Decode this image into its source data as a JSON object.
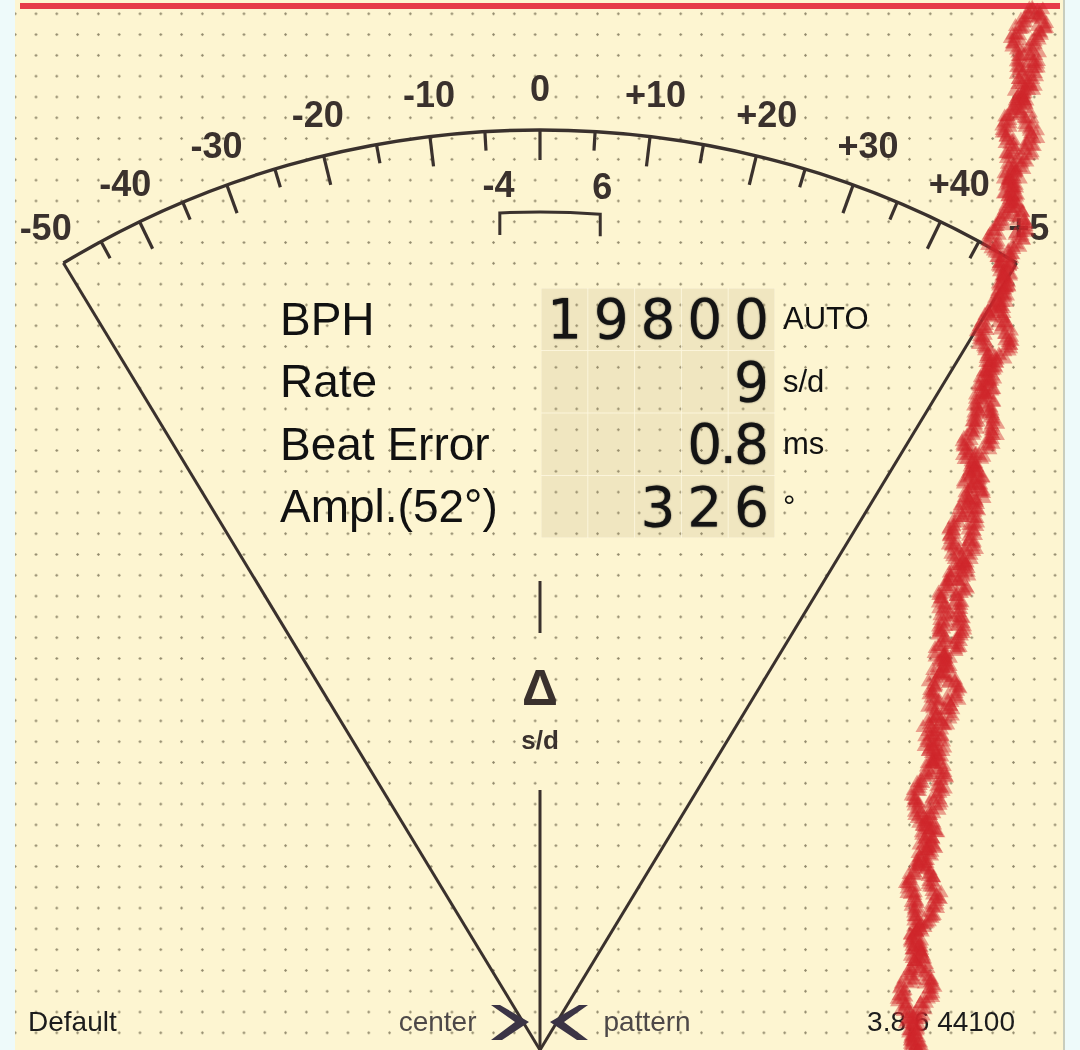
{
  "scale": {
    "labels": [
      "-50",
      "-40",
      "-30",
      "-20",
      "-10",
      "0",
      "+10",
      "+20",
      "+30",
      "+40",
      "+5"
    ],
    "tolerance": {
      "low": "-4",
      "high": "6"
    }
  },
  "readings": [
    {
      "label": "BPH",
      "value": "19800",
      "unit": "AUTO"
    },
    {
      "label": "Rate",
      "value": "9",
      "unit": "s/d"
    },
    {
      "label": "Beat Error",
      "value": "0.8",
      "unit": "ms"
    },
    {
      "label": "Ampl.(52°)",
      "value": "326",
      "unit": "°"
    }
  ],
  "center_mark": {
    "symbol": "Δ",
    "unit": "s/d"
  },
  "footer": {
    "profile": "Default",
    "left_hint": "center",
    "right_hint": "pattern",
    "version": "3.8.6 44100"
  }
}
